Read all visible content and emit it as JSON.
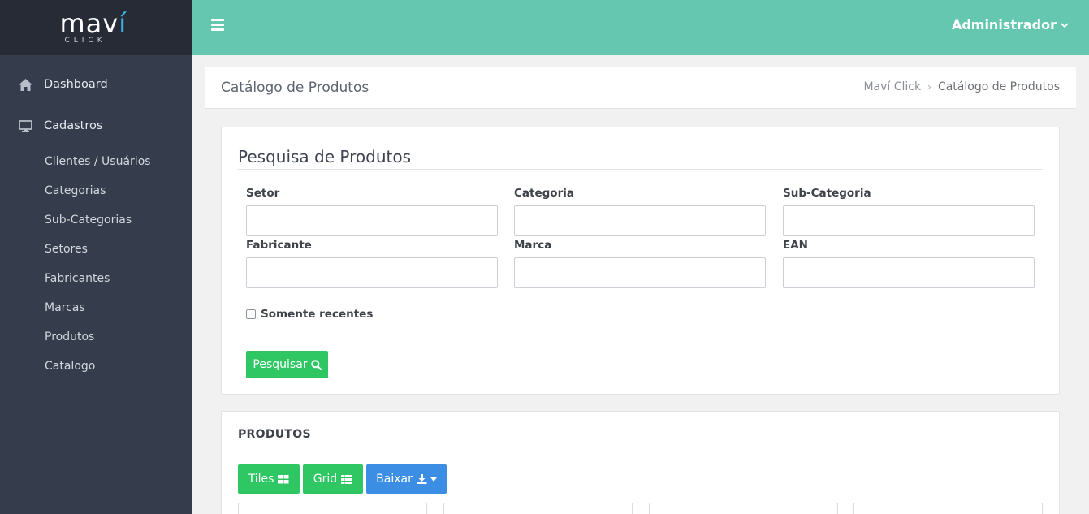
{
  "logo": {
    "text_main": "mav",
    "text_accent": "í",
    "text_sub": "CLICK"
  },
  "sidebar": {
    "items": [
      {
        "label": "Dashboard",
        "icon": "home-icon"
      },
      {
        "label": "Cadastros",
        "icon": "monitor-icon"
      }
    ],
    "subitems": [
      "Clientes / Usuários",
      "Categorias",
      "Sub-Categorias",
      "Setores",
      "Fabricantes",
      "Marcas",
      "Produtos",
      "Catalogo"
    ]
  },
  "topbar": {
    "user_label": "Administrador",
    "menu_icon": "hamburger-icon"
  },
  "page": {
    "title": "Catálogo de Produtos",
    "breadcrumb": {
      "root": "Maví Click",
      "current": "Catálogo de Produtos"
    }
  },
  "search": {
    "title": "Pesquisa de Produtos",
    "fields": {
      "setor": {
        "label": "Setor",
        "value": ""
      },
      "categoria": {
        "label": "Categoria",
        "value": ""
      },
      "subcategoria": {
        "label": "Sub-Categoria",
        "value": ""
      },
      "fabricante": {
        "label": "Fabricante",
        "value": ""
      },
      "marca": {
        "label": "Marca",
        "value": ""
      },
      "ean": {
        "label": "EAN",
        "value": ""
      }
    },
    "recent_label": "Somente recentes",
    "recent_checked": false,
    "button_label": "Pesquisar"
  },
  "products": {
    "title": "PRODUTOS",
    "tiles_label": "Tiles",
    "grid_label": "Grid",
    "download_label": "Baixar"
  },
  "colors": {
    "sidebar": "#353c4b",
    "logo_bg": "#262b35",
    "topbar": "#66c7b1",
    "green": "#2ec763",
    "blue": "#3b8ee3",
    "logo_accent": "#3ab5ec"
  }
}
